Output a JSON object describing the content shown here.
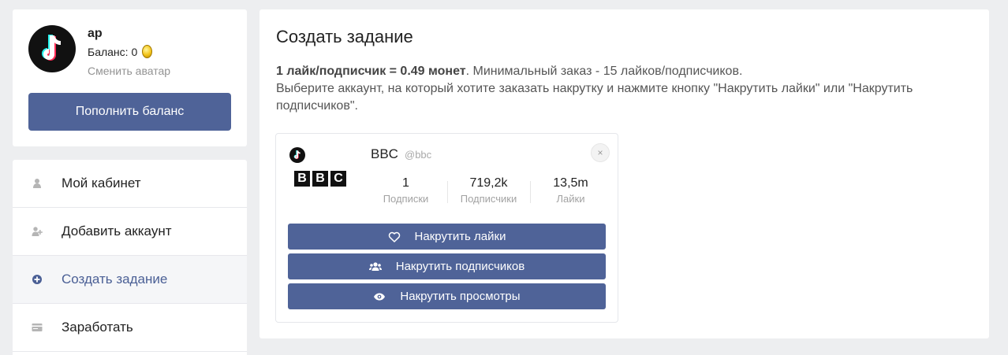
{
  "profile": {
    "username": "ар",
    "balance_label": "Баланс: 0",
    "change_avatar": "Сменить аватар",
    "topup_button": "Пополнить баланс"
  },
  "menu": {
    "items": [
      {
        "label": "Мой кабинет",
        "icon": "user-icon",
        "active": false
      },
      {
        "label": "Добавить аккаунт",
        "icon": "add-user-icon",
        "active": false
      },
      {
        "label": "Создать задание",
        "icon": "plus-circle-icon",
        "active": true
      },
      {
        "label": "Заработать",
        "icon": "card-icon",
        "active": false
      }
    ]
  },
  "main": {
    "title": "Создать задание",
    "rate_bold": "1 лайк/подписчик = 0.49 монет",
    "rate_rest": ". Минимальный заказ - 15 лайков/подписчиков.",
    "instructions": "Выберите аккаунт, на который хотите заказать накрутку и нажмите кнопку \"Накрутить лайки\" или \"Накрутить подписчиков\"."
  },
  "account": {
    "name": "BBC",
    "handle": "@bbc",
    "logo_letters": [
      "B",
      "B",
      "C"
    ],
    "close_glyph": "×",
    "stats": [
      {
        "value": "1",
        "label": "Подписки"
      },
      {
        "value": "719,2k",
        "label": "Подписчики"
      },
      {
        "value": "13,5m",
        "label": "Лайки"
      }
    ],
    "actions": [
      {
        "label": "Накрутить лайки",
        "icon": "heart-icon"
      },
      {
        "label": "Накрутить подписчиков",
        "icon": "users-icon"
      },
      {
        "label": "Накрутить просмотры",
        "icon": "eye-icon"
      }
    ]
  },
  "colors": {
    "accent": "#4f6398",
    "background": "#edeef0",
    "active_menu_text": "#4a5f95"
  }
}
